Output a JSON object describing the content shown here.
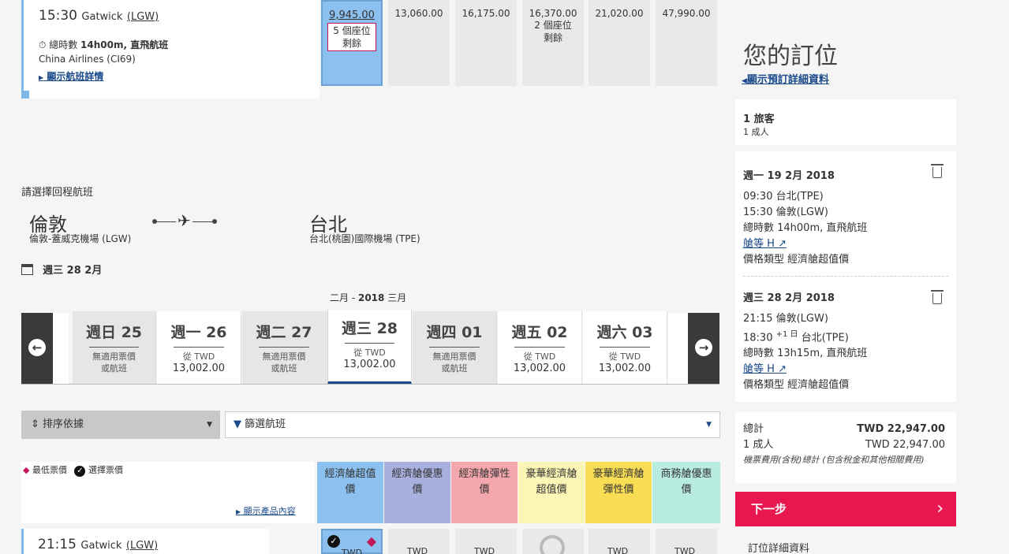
{
  "outbound": {
    "arrive_time": "15:30",
    "arrive_airport": "Gatwick",
    "arrive_code": "(LGW)",
    "duration_label": "總時數",
    "duration": "14h00m, 直飛航班",
    "airline": "China Airlines (CI69)",
    "details_link": "顯示航班詳情",
    "fares": [
      {
        "price": "9,945.00",
        "note": "5 個座位剩餘",
        "selected": true
      },
      {
        "price": "13,060.00",
        "note": ""
      },
      {
        "price": "16,175.00",
        "note": ""
      },
      {
        "price": "16,370.00",
        "note": "2 個座位剩餘"
      },
      {
        "price": "21,020.00",
        "note": ""
      },
      {
        "price": "47,990.00",
        "note": ""
      }
    ]
  },
  "return": {
    "prompt": "請選擇回程航班",
    "from_city": "倫敦",
    "from_airport": "倫敦-蓋威克機場 (LGW)",
    "to_city": "台北",
    "to_airport": "台北(桃園)國際機場 (TPE)",
    "date_label": "週三 28 2月",
    "month_range_a": "二月 - ",
    "month_range_b": "2018",
    "month_range_c": " 三月"
  },
  "days": [
    {
      "name": "週日 25",
      "l1": "無適用票價",
      "l2": "或航班",
      "available": false
    },
    {
      "name": "週一 26",
      "l1": "從 TWD",
      "l2": "13,002.00",
      "available": true
    },
    {
      "name": "週二 27",
      "l1": "無適用票價",
      "l2": "或航班",
      "available": false
    },
    {
      "name": "週三 28",
      "l1": "從 TWD",
      "l2": "13,002.00",
      "available": true,
      "selected": true
    },
    {
      "name": "週四 01",
      "l1": "無適用票價",
      "l2": "或航班",
      "available": false
    },
    {
      "name": "週五 02",
      "l1": "從 TWD",
      "l2": "13,002.00",
      "available": true
    },
    {
      "name": "週六 03",
      "l1": "從 TWD",
      "l2": "13,002.00",
      "available": true
    }
  ],
  "controls": {
    "sort_label": "排序依據",
    "filter_label": "篩選航班"
  },
  "legend": {
    "lowest": "最低票價",
    "selected": "選擇票價",
    "product_link": "顯示產品內容"
  },
  "fare_columns": [
    {
      "l1": "經濟艙超值",
      "l2": "價",
      "color": "#8cc0ee"
    },
    {
      "l1": "經濟艙優惠",
      "l2": "價",
      "color": "#a8b1dd"
    },
    {
      "l1": "經濟艙彈性",
      "l2": "價",
      "color": "#f4a7ad"
    },
    {
      "l1": "豪華經濟艙",
      "l2": "超值價",
      "color": "#fbf5b6"
    },
    {
      "l1": "豪華經濟艙",
      "l2": "彈性價",
      "color": "#f8dd55"
    },
    {
      "l1": "商務艙優惠",
      "l2": "價",
      "color": "#b8ece0"
    }
  ],
  "return_flight": {
    "depart_time": "21:15",
    "depart_airport": "Gatwick",
    "depart_code": "(LGW)",
    "price_stub": "TWD"
  },
  "booking": {
    "title": "您的訂位",
    "details_link": "顯示預訂詳細資料",
    "pax_count": "1 旅客",
    "pax_type": "1 成人",
    "leg1": {
      "date": "週一 19 2月 2018",
      "depart": "09:30 台北(TPE)",
      "arrive": "15:30 倫敦(LGW)",
      "duration": "總時數 14h00m, 直飛航班",
      "cabin": "艙等 H",
      "fare_type": "價格類型 經濟艙超值價"
    },
    "leg2": {
      "date": "週三 28 2月 2018",
      "depart": "21:15 倫敦(LGW)",
      "arrive_time": "18:30",
      "arrive_plus": "+1 日",
      "arrive_place": "台北(TPE)",
      "duration": "總時數 13h15m, 直飛航班",
      "cabin": "艙等 H",
      "fare_type": "價格類型 經濟艙超值價"
    },
    "total_label": "總計",
    "total_value": "TWD 22,947.00",
    "adult_label": "1 成人",
    "adult_value": "TWD 22,947.00",
    "tax_note": "機票費用(含稅)總計 (包含稅金和其他相關費用)",
    "next_label": "下一步",
    "footer_label": "訂位詳細資料",
    "colors": {
      "next": "#e8174f",
      "accent": "#1a4a8a"
    }
  }
}
